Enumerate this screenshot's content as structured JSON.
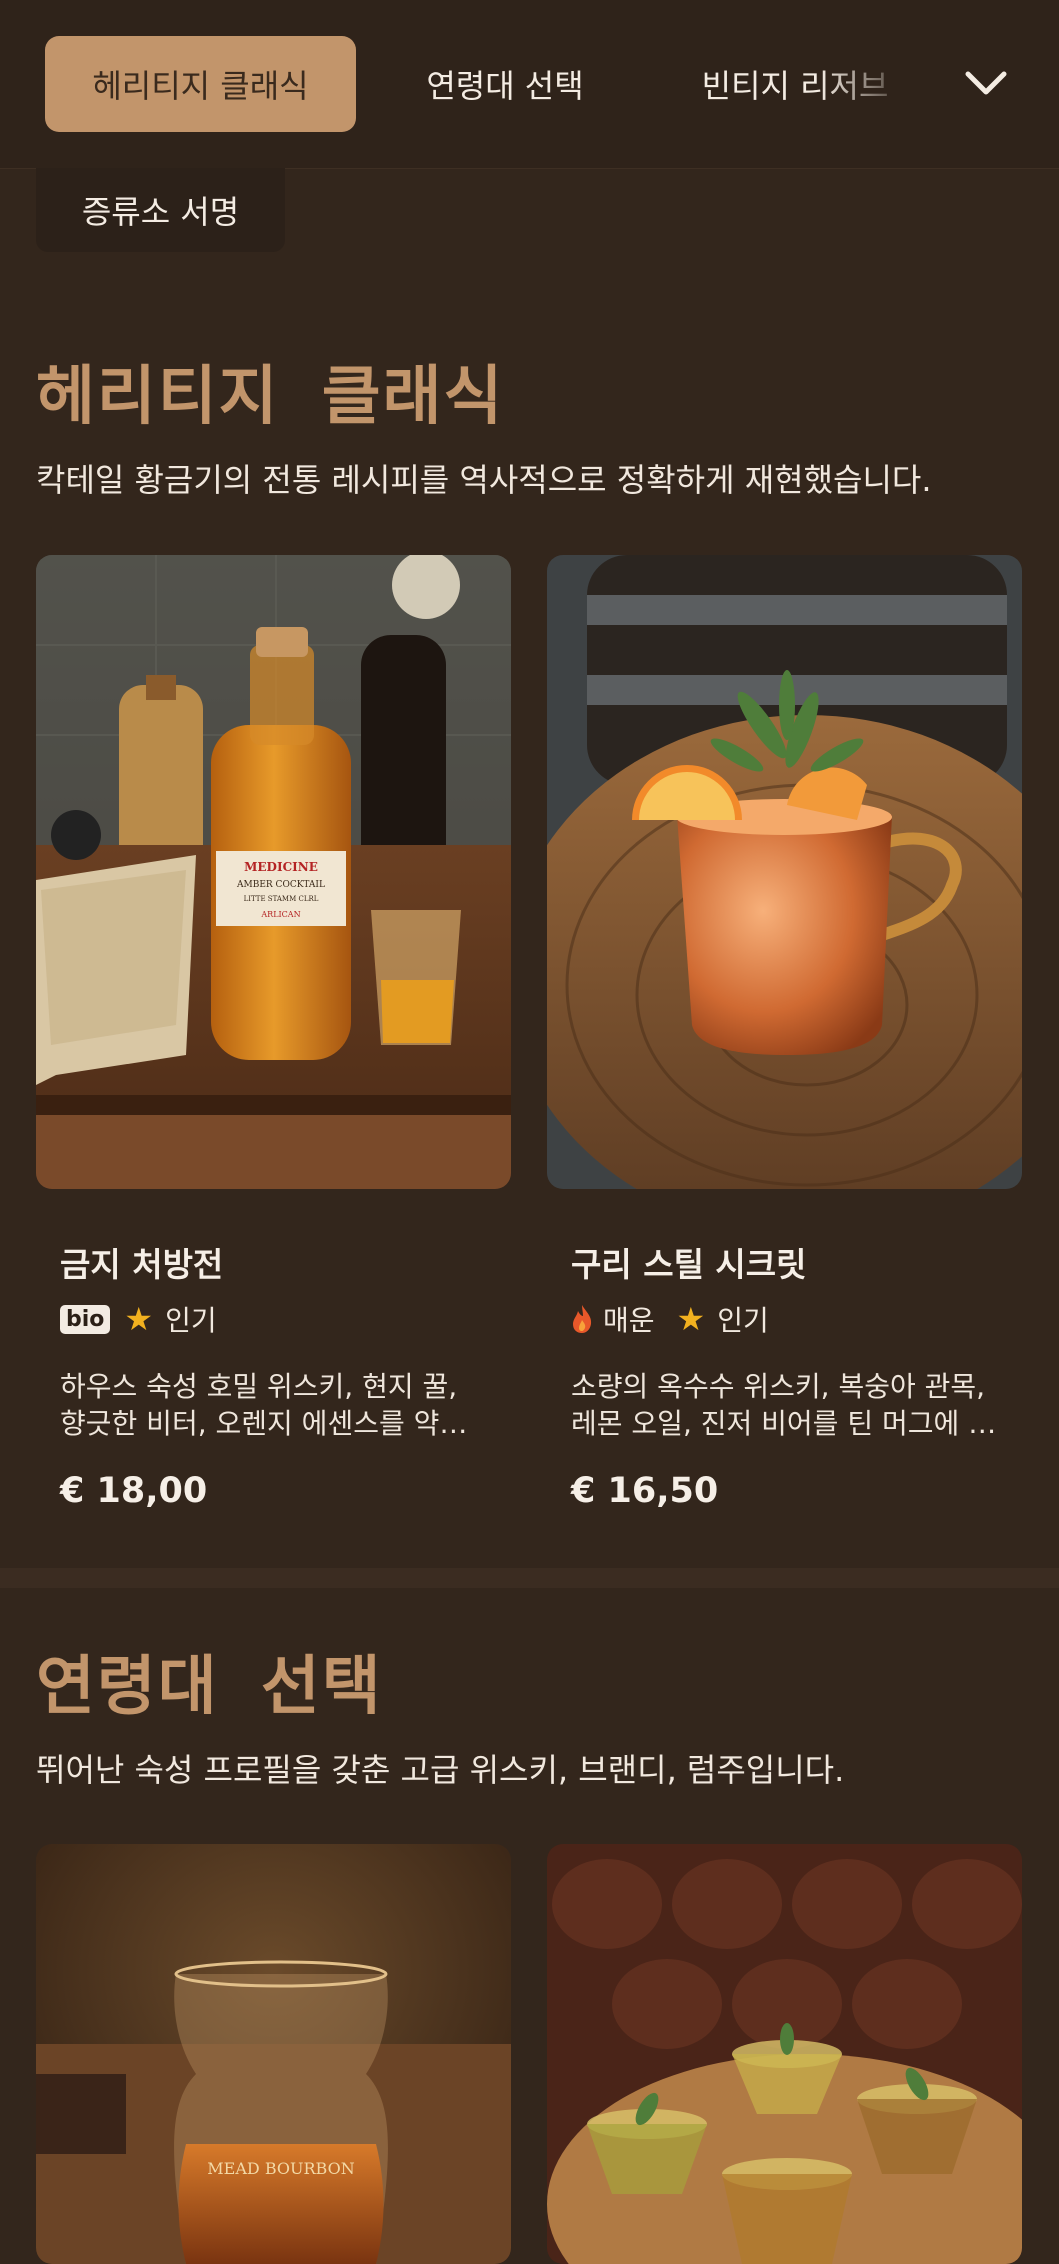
{
  "tabs": [
    {
      "label": "헤리티지 클래식",
      "active": true
    },
    {
      "label": "연령대 선택",
      "active": false
    },
    {
      "label": "빈티지 리저브",
      "active": false
    },
    {
      "label": "증류소 서명",
      "active": false
    }
  ],
  "expand_icon": "chevron-down-icon",
  "sections": [
    {
      "title": "헤리티지 클래식",
      "description": "칵테일 황금기의 전통 레시피를 역사적으로 정확하게 재현했습니다.",
      "items": [
        {
          "name": "금지 처방전",
          "tags": [
            {
              "type": "bio",
              "label": "bio"
            },
            {
              "type": "star",
              "label": "인기"
            }
          ],
          "description": "하우스 숙성 호밀 위스키, 현지 꿀, 향긋한 비터, 오렌지 에센스를 약병에 담아 제공합니다.",
          "price": "€ 18,00"
        },
        {
          "name": "구리 스틸 시크릿",
          "tags": [
            {
              "type": "flame",
              "label": "매운"
            },
            {
              "type": "star",
              "label": "인기"
            }
          ],
          "description": "소량의 옥수수 위스키, 복숭아 관목, 레몬 오일, 진저 비어를 틴 머그에 담아 제공합니다.",
          "price": "€ 16,50"
        }
      ]
    },
    {
      "title": "연령대 선택",
      "description": "뛰어난 숙성 프로필을 갖춘 고급 위스키, 브랜디, 럼주입니다."
    }
  ],
  "photo_text": {
    "medicine_label": [
      "MEDICINE",
      "AMBER COCKTAIL",
      "LITTE STAMM CLRL",
      "ARLICAN"
    ],
    "glass_label": "MEAD BOURBON"
  },
  "colors": {
    "background": "#33261c",
    "accent": "#c2956b",
    "star": "#f2b11f",
    "flame": "#e8582a"
  }
}
